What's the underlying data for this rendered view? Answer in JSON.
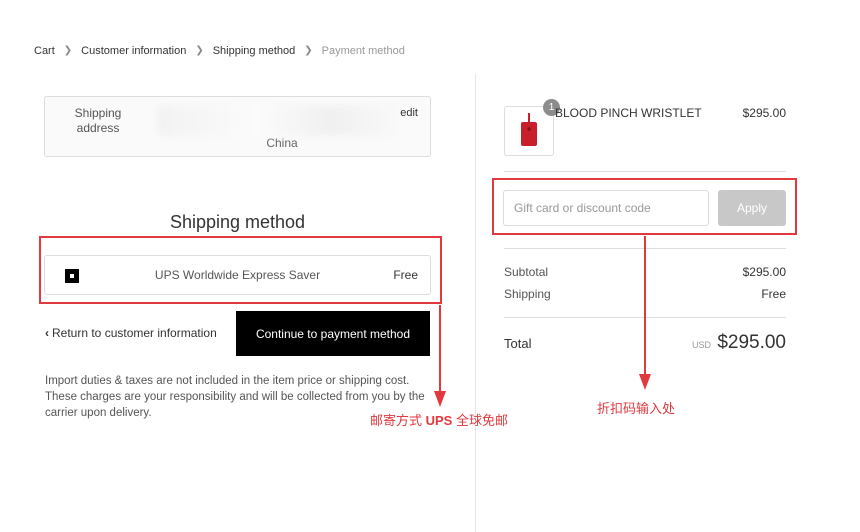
{
  "breadcrumb": {
    "items": [
      "Cart",
      "Customer information",
      "Shipping method",
      "Payment method"
    ]
  },
  "shipping_address": {
    "label": "Shipping address",
    "country": "China",
    "edit_label": "edit"
  },
  "shipping_method": {
    "title": "Shipping method",
    "option_name": "UPS Worldwide Express Saver",
    "option_price": "Free"
  },
  "actions": {
    "return_label": "Return to customer information",
    "continue_label": "Continue to payment method"
  },
  "notice": "Import duties & taxes are not included in the item price or shipping cost. These charges are your responsibility and will be collected from you by the carrier upon delivery.",
  "annotations": {
    "shipping_prefix": "邮寄方式 ",
    "shipping_bold": "UPS",
    "shipping_suffix": " 全球免邮",
    "discount": "折扣码输入处"
  },
  "order": {
    "product_qty": "1",
    "product_name": "BLOOD PINCH WRISTLET",
    "product_price": "$295.00",
    "discount_placeholder": "Gift card or discount code",
    "apply_label": "Apply",
    "subtotal_label": "Subtotal",
    "subtotal_value": "$295.00",
    "shipping_label": "Shipping",
    "shipping_value": "Free",
    "total_label": "Total",
    "total_currency": "USD",
    "total_value": "$295.00"
  },
  "colors": {
    "annotation_red": "#e0393e",
    "product_red": "#c8202a",
    "button_black": "#000000",
    "apply_disabled": "#c8c8c8"
  }
}
